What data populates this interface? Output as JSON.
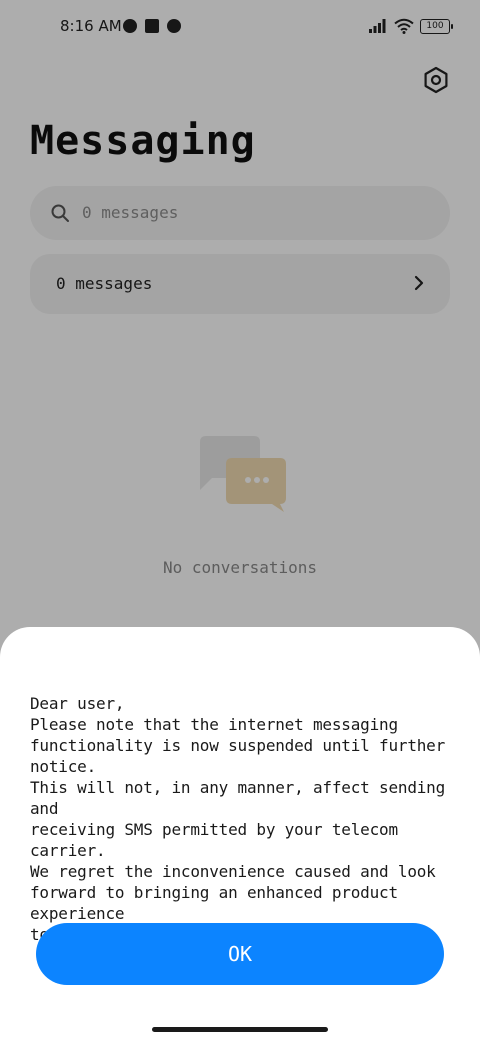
{
  "status_bar": {
    "time": "8:16 AM",
    "battery": "100"
  },
  "header": {
    "title": "Messaging",
    "settings_icon": "gear-icon"
  },
  "search": {
    "placeholder": "0 messages",
    "icon": "search-icon"
  },
  "message_card": {
    "label": "0 messages",
    "icon": "chevron-right-icon"
  },
  "empty_state": {
    "text": "No conversations",
    "icon": "chat-bubbles-icon"
  },
  "dialog": {
    "body": "Dear user,\nPlease note that the internet messaging\nfunctionality is now suspended until further notice.\nThis will not, in any manner, affect sending and\nreceiving SMS permitted by your telecom carrier.\nWe regret the inconvenience caused and look\nforward to bringing an enhanced product experience\nto you with our future updates.",
    "ok_label": "OK"
  },
  "colors": {
    "accent": "#0c84ff",
    "dim_overlay": "rgba(0,0,0,0.32)",
    "card_bg": "#f2f2f2"
  }
}
